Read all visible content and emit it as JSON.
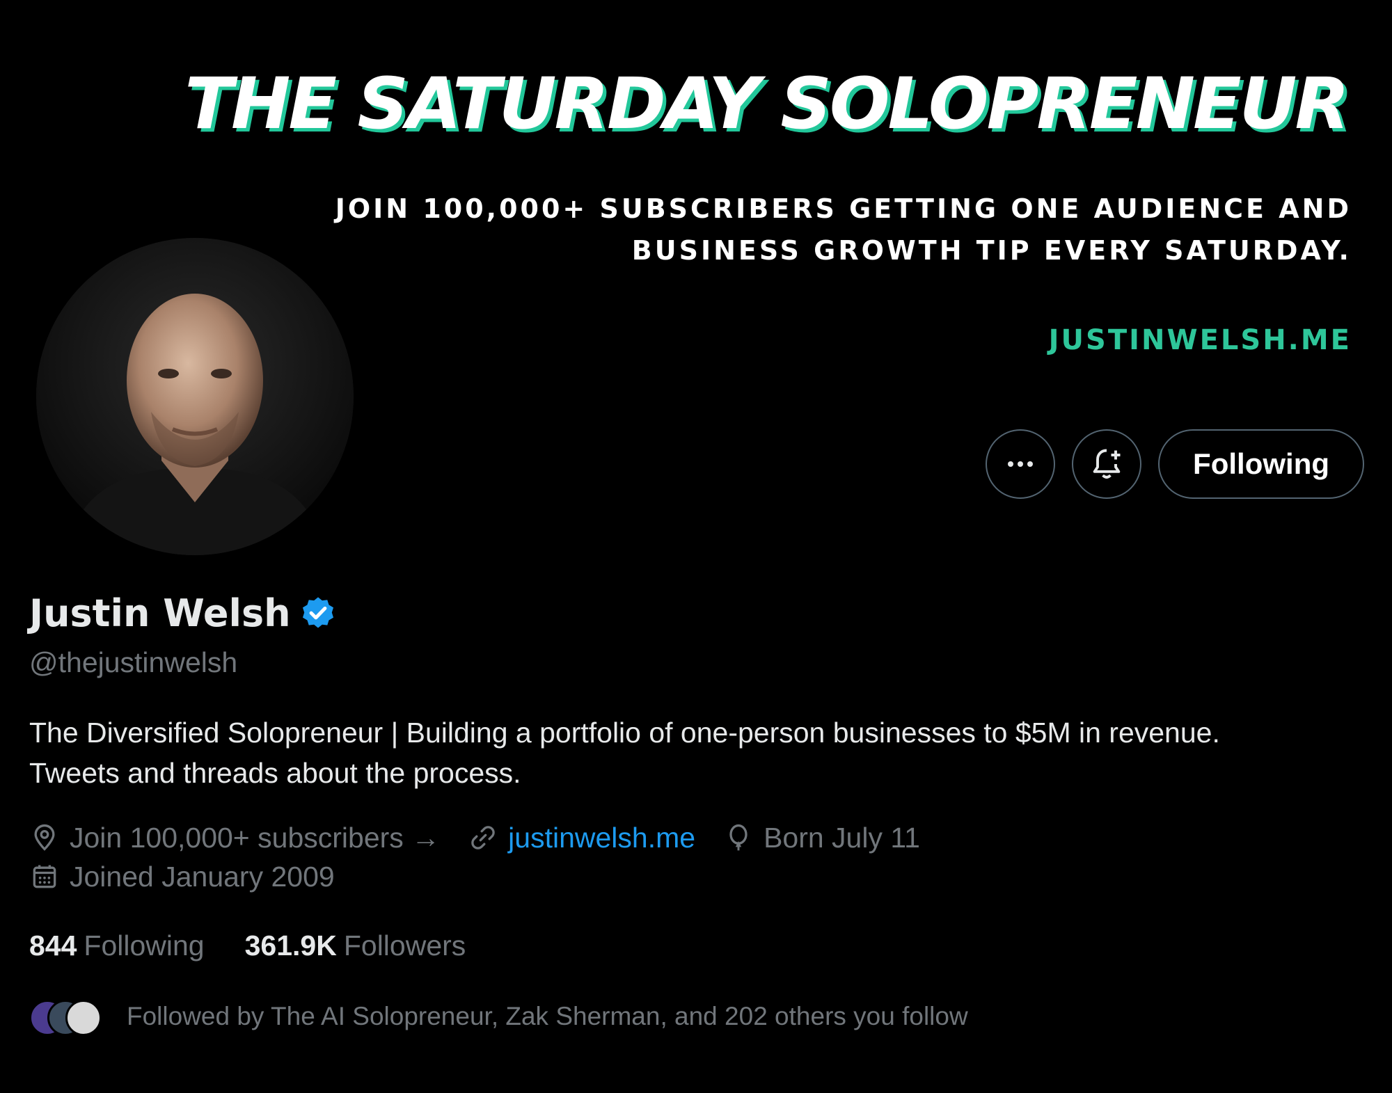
{
  "banner": {
    "title": "THE SATURDAY SOLOPRENEUR",
    "tagline_line1": "JOIN 100,000+ SUBSCRIBERS GETTING ONE AUDIENCE AND",
    "tagline_line2": "BUSINESS GROWTH TIP EVERY SATURDAY.",
    "url": "JUSTINWELSH.ME"
  },
  "actions": {
    "more_icon": "more-icon",
    "bell_icon": "notification-bell-plus-icon",
    "following_label": "Following"
  },
  "profile": {
    "name": "Justin Welsh",
    "verified_icon": "verified-badge-icon",
    "handle": "@thejustinwelsh",
    "bio_line1": "The Diversified Solopreneur | Building a portfolio of one-person businesses to $5M in revenue.",
    "bio_line2": "Tweets and threads about the process.",
    "location": "Join 100,000+ subscribers →",
    "website": "justinwelsh.me",
    "birthday": "Born July 11",
    "joined": "Joined January 2009"
  },
  "stats": {
    "following_count": "844",
    "following_label": "Following",
    "followers_count": "361.9K",
    "followers_label": "Followers"
  },
  "followed_by": "Followed by The AI Solopreneur, Zak Sherman, and 202 others you follow",
  "colors": {
    "accent_teal": "#2ec69a",
    "link_blue": "#1d9bf0",
    "muted_text": "#71767b",
    "verified_blue": "#1d9bf0"
  }
}
